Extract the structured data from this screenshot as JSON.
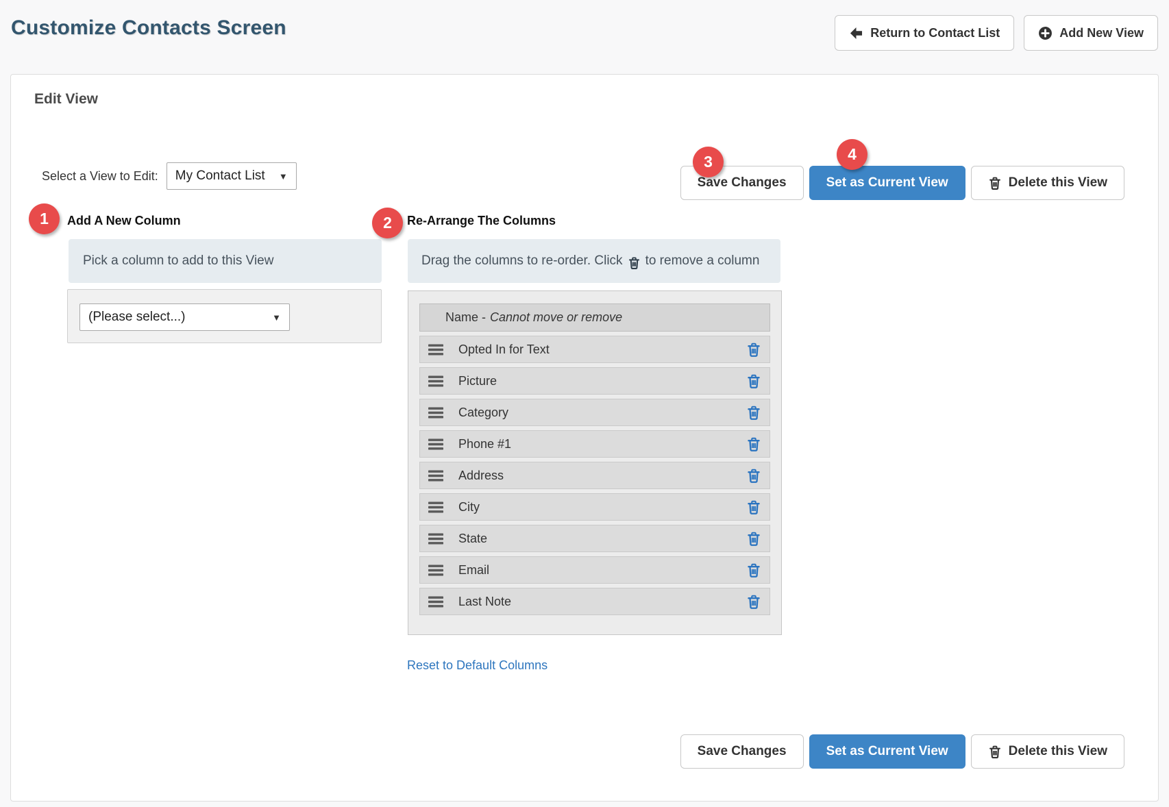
{
  "colors": {
    "accent_blue": "#3d85c6",
    "badge_red": "#e84b4b",
    "link_blue": "#2e76be",
    "row_trash_blue": "#2b74c0",
    "title_color": "#33566e"
  },
  "icons": {
    "caret": "▼"
  },
  "header": {
    "title": "Customize Contacts Screen",
    "return_button": "Return to Contact List",
    "add_view_button": "Add New View"
  },
  "panel": {
    "title": "Edit View",
    "view_selector": {
      "label": "Select a View to Edit:",
      "value": "My Contact List"
    }
  },
  "actions": {
    "save": "Save Changes",
    "set_current": "Set as Current View",
    "delete": "Delete this View"
  },
  "badges": {
    "add_column": "1",
    "rearrange": "2",
    "save": "3",
    "set_current": "4"
  },
  "add_column": {
    "heading": "Add A New Column",
    "info": "Pick a column to add to this View",
    "select_value": "(Please select...)"
  },
  "rearrange": {
    "heading": "Re-Arrange The Columns",
    "info_before": "Drag the columns to re-order. Click",
    "info_after": "to remove a column",
    "header_name": "Name -",
    "header_note": "Cannot move or remove",
    "columns": [
      "Opted In for Text",
      "Picture",
      "Category",
      "Phone #1",
      "Address",
      "City",
      "State",
      "Email",
      "Last Note"
    ],
    "reset_link": "Reset to Default Columns"
  }
}
